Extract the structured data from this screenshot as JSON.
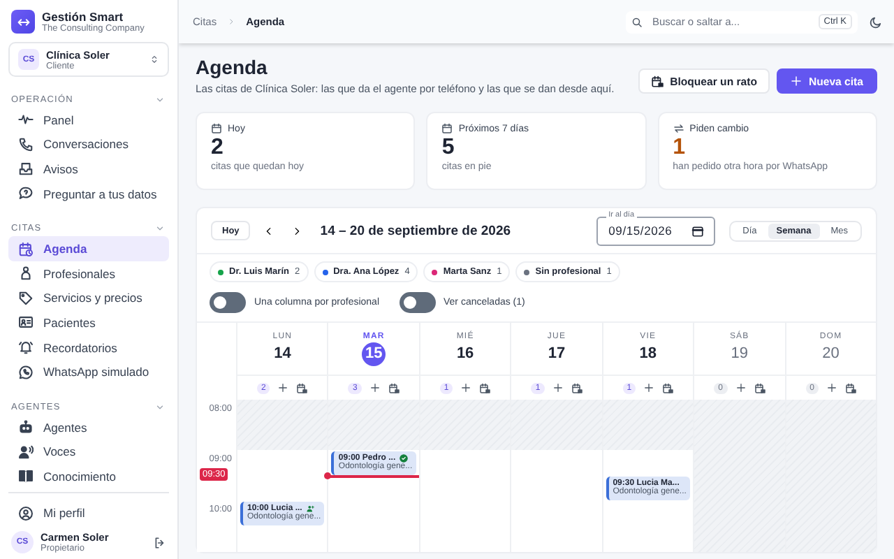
{
  "brand": {
    "name": "Gestión Smart",
    "tagline": "The Consulting Company"
  },
  "workspace": {
    "initials": "CS",
    "name": "Clínica Soler",
    "role": "Cliente"
  },
  "nav_sections": [
    {
      "title": "OPERACIÓN",
      "expanded": true,
      "items": [
        {
          "label": "Panel",
          "selected": false
        },
        {
          "label": "Conversaciones",
          "selected": false
        },
        {
          "label": "Avisos",
          "selected": false
        },
        {
          "label": "Preguntar a tus datos",
          "selected": false
        }
      ]
    },
    {
      "title": "CITAS",
      "expanded": true,
      "items": [
        {
          "label": "Agenda",
          "selected": true
        },
        {
          "label": "Profesionales",
          "selected": false
        },
        {
          "label": "Servicios y precios",
          "selected": false
        },
        {
          "label": "Pacientes",
          "selected": false
        },
        {
          "label": "Recordatorios",
          "selected": false
        },
        {
          "label": "WhatsApp simulado",
          "selected": false
        }
      ]
    },
    {
      "title": "AGENTES",
      "expanded": true,
      "items": [
        {
          "label": "Agentes",
          "selected": false
        },
        {
          "label": "Voces",
          "selected": false
        },
        {
          "label": "Conocimiento",
          "selected": false
        }
      ]
    }
  ],
  "profile_link": "Mi perfil",
  "user": {
    "initials": "CS",
    "name": "Carmen Soler",
    "role": "Propietario"
  },
  "breadcrumb": [
    "Citas",
    "Agenda"
  ],
  "search": {
    "placeholder": "Buscar o saltar a...",
    "shortcut": "Ctrl K"
  },
  "page": {
    "title": "Agenda",
    "subtitle": "Las citas de Clínica Soler: las que da el agente por teléfono y las que se dan desde aquí."
  },
  "actions": [
    {
      "label": "Bloquear un rato",
      "kind": "secondary"
    },
    {
      "label": "Nueva cita",
      "kind": "primary"
    }
  ],
  "stats": [
    {
      "label": "Hoy",
      "value": "2",
      "note": "citas que quedan hoy",
      "highlight": false
    },
    {
      "label": "Próximos 7 días",
      "value": "5",
      "note": "citas en pie",
      "highlight": false
    },
    {
      "label": "Piden cambio",
      "value": "1",
      "note": "han pedido otra hora por WhatsApp",
      "highlight": true
    }
  ],
  "calendar": {
    "today_button": "Hoy",
    "range": "14 – 20 de septiembre de 2026",
    "date_field": {
      "label": "Ir al día",
      "value": "09/15/2026"
    },
    "views": [
      {
        "label": "Día",
        "selected": false
      },
      {
        "label": "Semana",
        "selected": true
      },
      {
        "label": "Mes",
        "selected": false
      }
    ],
    "professionals": [
      {
        "name": "Dr. Luis Marín",
        "count": "2",
        "color": "#16a34a"
      },
      {
        "name": "Dra. Ana López",
        "count": "4",
        "color": "#2563eb"
      },
      {
        "name": "Marta Sanz",
        "count": "1",
        "color": "#db2777"
      },
      {
        "name": "Sin profesional",
        "count": "1",
        "color": "#6b7280"
      }
    ],
    "toggles": [
      {
        "label": "Una columna por profesional",
        "on": false
      },
      {
        "label": "Ver canceladas (1)",
        "on": false
      }
    ],
    "days": [
      {
        "weekday": "LUN",
        "date": "14",
        "count": "2",
        "selected": false,
        "closed": false,
        "appointments": [
          {
            "time": "10:00",
            "name": "Lucia ...",
            "service": "Odontología gene...",
            "confirmed": false,
            "new_patient": true
          }
        ]
      },
      {
        "weekday": "MAR",
        "date": "15",
        "count": "3",
        "selected": true,
        "closed": false,
        "appointments": [
          {
            "time": "09:00",
            "name": "Pedro ...",
            "service": "Odontología gene...",
            "confirmed": true,
            "new_patient": false
          }
        ]
      },
      {
        "weekday": "MIÉ",
        "date": "16",
        "count": "1",
        "selected": false,
        "closed": false
      },
      {
        "weekday": "JUE",
        "date": "17",
        "count": "1",
        "selected": false,
        "closed": false
      },
      {
        "weekday": "VIE",
        "date": "18",
        "count": "1",
        "selected": false,
        "closed": false,
        "appointments": [
          {
            "time": "09:30",
            "name": "Lucia Ma...",
            "service": "Odontología gene...",
            "confirmed": false,
            "new_patient": false
          }
        ]
      },
      {
        "weekday": "SÁB",
        "date": "19",
        "count": "0",
        "selected": false,
        "closed": true
      },
      {
        "weekday": "DOM",
        "date": "20",
        "count": "0",
        "selected": false,
        "closed": true
      }
    ],
    "hours": [
      "08:00",
      "09:00",
      "10:00"
    ],
    "now": "09:30"
  }
}
